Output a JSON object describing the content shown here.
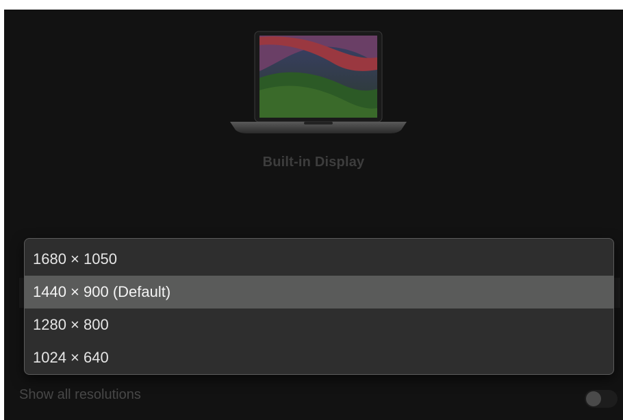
{
  "display": {
    "title": "Built-in Display",
    "icon": "laptop-display-icon"
  },
  "resolutions": {
    "selected_index": 1,
    "items": [
      {
        "label": "1680 × 1050"
      },
      {
        "label": "1440 × 900 (Default)"
      },
      {
        "label": "1280 × 800"
      },
      {
        "label": "1024 × 640"
      }
    ]
  },
  "show_all": {
    "label": "Show all resolutions",
    "enabled": false
  },
  "colors": {
    "background": "#121212",
    "popup": "#2e2e2e",
    "selected": "#5a5b5a"
  }
}
